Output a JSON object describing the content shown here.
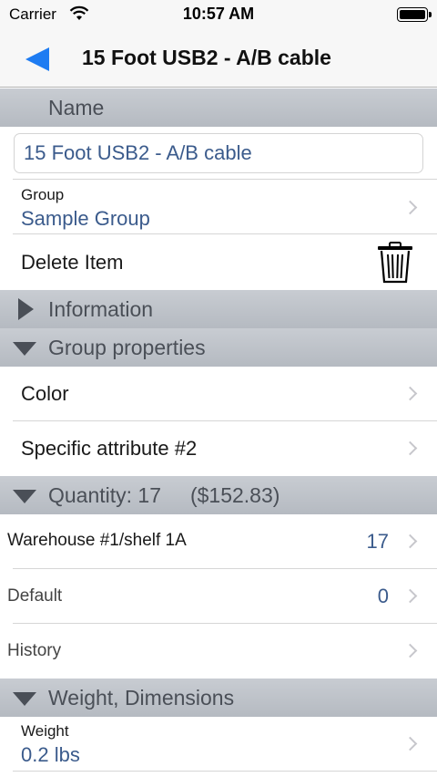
{
  "status": {
    "carrier": "Carrier",
    "time": "10:57 AM"
  },
  "nav": {
    "title": "15 Foot USB2 - A/B cable"
  },
  "sections": {
    "name": "Name",
    "information": "Information",
    "group_properties": "Group properties",
    "quantity": "Quantity: 17     ($152.83)",
    "weight_dimensions": "Weight, Dimensions"
  },
  "item": {
    "name_value": "15 Foot USB2 - A/B cable",
    "group_label": "Group",
    "group_value": "Sample Group",
    "delete_label": "Delete Item"
  },
  "group_properties": {
    "color_label": "Color",
    "attribute_label": "Specific attribute #2"
  },
  "quantity": {
    "locations": [
      {
        "label": "Warehouse #1/shelf 1A",
        "count": "17"
      },
      {
        "label": "Default",
        "count": "0"
      }
    ],
    "history_label": "History"
  },
  "weight": {
    "label": "Weight",
    "value": "0.2 lbs"
  }
}
